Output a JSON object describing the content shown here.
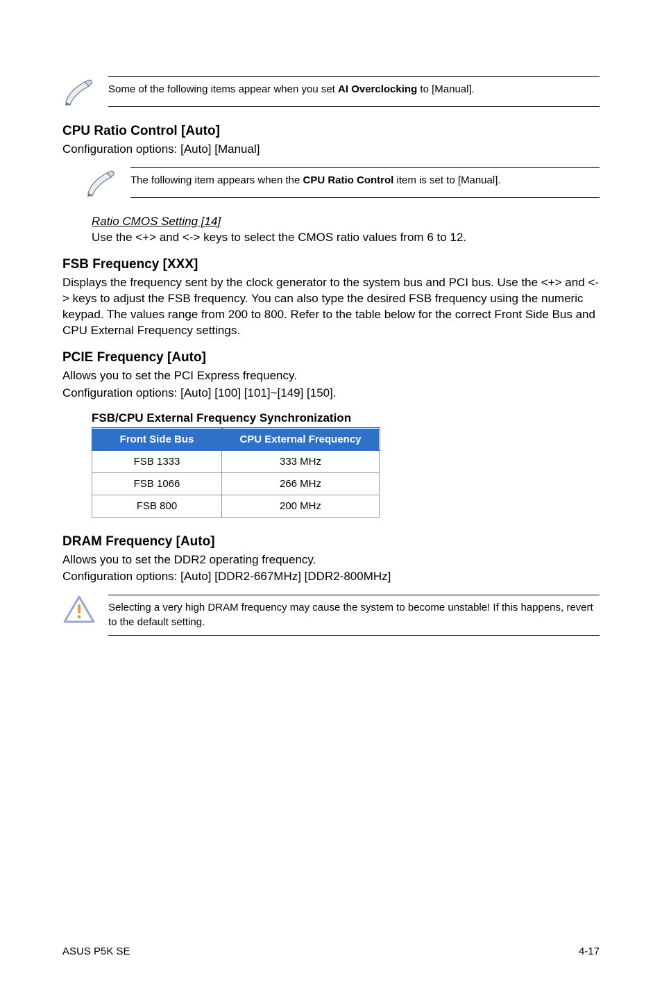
{
  "note1": {
    "text_a": "Some of the following items appear when you set ",
    "bold": "AI Overclocking",
    "text_b": " to [Manual]."
  },
  "cpu_ratio": {
    "heading": "CPU Ratio Control [Auto]",
    "body": "Configuration options: [Auto] [Manual]"
  },
  "note2": {
    "text_a": "The following item appears when the ",
    "bold": "CPU Ratio Control",
    "text_b": " item is set to [Manual]."
  },
  "ratio_cmos": {
    "title": "Ratio CMOS Setting [14]",
    "desc": "Use the <+> and <-> keys to select the CMOS ratio values from 6 to 12."
  },
  "fsb": {
    "heading": "FSB Frequency [XXX]",
    "body": "Displays the frequency sent by the clock generator to the system bus and PCI bus. Use the <+> and <-> keys to adjust the FSB frequency. You can also type the desired FSB frequency using the numeric keypad. The values range from 200 to 800. Refer to the table below for the correct Front Side Bus and CPU External Frequency settings."
  },
  "pcie": {
    "heading": "PCIE Frequency [Auto]",
    "body1": "Allows you to set the PCI Express frequency.",
    "body2": "Configuration options: [Auto] [100] [101]~[149] [150]."
  },
  "table": {
    "caption": "FSB/CPU External Frequency Synchronization",
    "head1": "Front Side Bus",
    "head2": "CPU External Frequency",
    "rows": [
      {
        "c1": "FSB 1333",
        "c2": "333 MHz"
      },
      {
        "c1": "FSB 1066",
        "c2": "266 MHz"
      },
      {
        "c1": "FSB 800",
        "c2": "200 MHz"
      }
    ]
  },
  "dram": {
    "heading": "DRAM Frequency [Auto]",
    "body1": "Allows you to set the DDR2 operating frequency.",
    "body2": "Configuration options: [Auto] [DDR2-667MHz] [DDR2-800MHz]"
  },
  "note3": {
    "text": "Selecting a very high DRAM frequency may cause the system to become unstable! If this happens, revert to the default setting."
  },
  "footer": {
    "left": "ASUS P5K SE",
    "right": "4-17"
  }
}
